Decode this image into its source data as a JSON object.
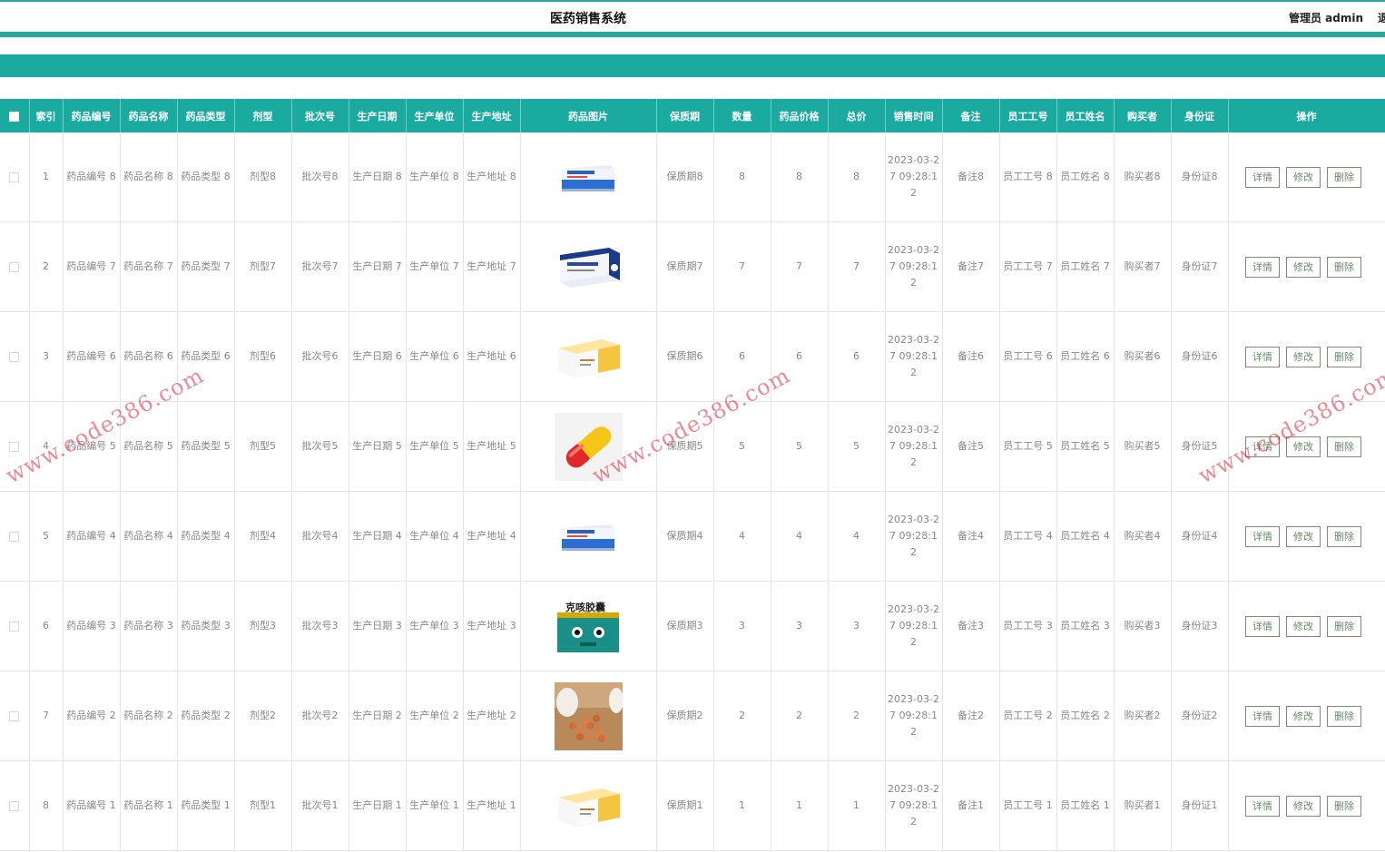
{
  "header": {
    "title": "医药销售系统",
    "user": "管理员 admin",
    "logout": "退"
  },
  "colors": {
    "accent": "#1aaaa0"
  },
  "table": {
    "columns": [
      "索引",
      "药品编号",
      "药品名称",
      "药品类型",
      "剂型",
      "批次号",
      "生产日期",
      "生产单位",
      "生产地址",
      "药品图片",
      "保质期",
      "数量",
      "药品价格",
      "总价",
      "销售时间",
      "备注",
      "员工工号",
      "员工姓名",
      "购买者",
      "身份证",
      "操作"
    ],
    "actions": {
      "detail": "详情",
      "edit": "修改",
      "delete": "删除"
    },
    "rows": [
      {
        "index": "1",
        "code": "药品编号 8",
        "name": "药品名称 8",
        "type": "药品类型 8",
        "dosage": "剂型8",
        "batch": "批次号8",
        "date": "生产日期 8",
        "unit": "生产单位 8",
        "address": "生产地址 8",
        "image": "blue-white-pill-box",
        "shelf": "保质期8",
        "qty": "8",
        "price": "8",
        "total": "8",
        "time": "2023-03-27 09:28:12",
        "note": "备注8",
        "emp_no": "员工工号 8",
        "emp_name": "员工姓名 8",
        "buyer": "购买者8",
        "idcard": "身份证8"
      },
      {
        "index": "2",
        "code": "药品编号 7",
        "name": "药品名称 7",
        "type": "药品类型 7",
        "dosage": "剂型7",
        "batch": "批次号7",
        "date": "生产日期 7",
        "unit": "生产单位 7",
        "address": "生产地址 7",
        "image": "dark-blue-medicine-box",
        "shelf": "保质期7",
        "qty": "7",
        "price": "7",
        "total": "7",
        "time": "2023-03-27 09:28:12",
        "note": "备注7",
        "emp_no": "员工工号 7",
        "emp_name": "员工姓名 7",
        "buyer": "购买者7",
        "idcard": "身份证7"
      },
      {
        "index": "3",
        "code": "药品编号 6",
        "name": "药品名称 6",
        "type": "药品类型 6",
        "dosage": "剂型6",
        "batch": "批次号6",
        "date": "生产日期 6",
        "unit": "生产单位 6",
        "address": "生产地址 6",
        "image": "yellow-white-medicine-box",
        "shelf": "保质期6",
        "qty": "6",
        "price": "6",
        "total": "6",
        "time": "2023-03-27 09:28:12",
        "note": "备注6",
        "emp_no": "员工工号 6",
        "emp_name": "员工姓名 6",
        "buyer": "购买者6",
        "idcard": "身份证6"
      },
      {
        "index": "4",
        "code": "药品编号 5",
        "name": "药品名称 5",
        "type": "药品类型 5",
        "dosage": "剂型5",
        "batch": "批次号5",
        "date": "生产日期 5",
        "unit": "生产单位 5",
        "address": "生产地址 5",
        "image": "red-yellow-capsule",
        "shelf": "保质期5",
        "qty": "5",
        "price": "5",
        "total": "5",
        "time": "2023-03-27 09:28:12",
        "note": "备注5",
        "emp_no": "员工工号 5",
        "emp_name": "员工姓名 5",
        "buyer": "购买者5",
        "idcard": "身份证5"
      },
      {
        "index": "5",
        "code": "药品编号 4",
        "name": "药品名称 4",
        "type": "药品类型 4",
        "dosage": "剂型4",
        "batch": "批次号4",
        "date": "生产日期 4",
        "unit": "生产单位 4",
        "address": "生产地址 4",
        "image": "blue-white-pill-box",
        "shelf": "保质期4",
        "qty": "4",
        "price": "4",
        "total": "4",
        "time": "2023-03-27 09:28:12",
        "note": "备注4",
        "emp_no": "员工工号 4",
        "emp_name": "员工姓名 4",
        "buyer": "购买者4",
        "idcard": "身份证4"
      },
      {
        "index": "6",
        "code": "药品编号 3",
        "name": "药品名称 3",
        "type": "药品类型 3",
        "dosage": "剂型3",
        "batch": "批次号3",
        "date": "生产日期 3",
        "unit": "生产单位 3",
        "address": "生产地址 3",
        "image": "teal-cough-medicine-box",
        "shelf": "保质期3",
        "qty": "3",
        "price": "3",
        "total": "3",
        "time": "2023-03-27 09:28:12",
        "note": "备注3",
        "emp_no": "员工工号 3",
        "emp_name": "员工姓名 3",
        "buyer": "购买者3",
        "idcard": "身份证3"
      },
      {
        "index": "7",
        "code": "药品编号 2",
        "name": "药品名称 2",
        "type": "药品类型 2",
        "dosage": "剂型2",
        "batch": "批次号2",
        "date": "生产日期 2",
        "unit": "生产单位 2",
        "address": "生产地址 2",
        "image": "brown-pills-bottle",
        "shelf": "保质期2",
        "qty": "2",
        "price": "2",
        "total": "2",
        "time": "2023-03-27 09:28:12",
        "note": "备注2",
        "emp_no": "员工工号 2",
        "emp_name": "员工姓名 2",
        "buyer": "购买者2",
        "idcard": "身份证2"
      },
      {
        "index": "8",
        "code": "药品编号 1",
        "name": "药品名称 1",
        "type": "药品类型 1",
        "dosage": "剂型1",
        "batch": "批次号1",
        "date": "生产日期 1",
        "unit": "生产单位 1",
        "address": "生产地址 1",
        "image": "yellow-white-medicine-box",
        "shelf": "保质期1",
        "qty": "1",
        "price": "1",
        "total": "1",
        "time": "2023-03-27 09:28:12",
        "note": "备注1",
        "emp_no": "员工工号 1",
        "emp_name": "员工姓名 1",
        "buyer": "购买者1",
        "idcard": "身份证1"
      }
    ]
  },
  "watermark": "www.code386.com"
}
